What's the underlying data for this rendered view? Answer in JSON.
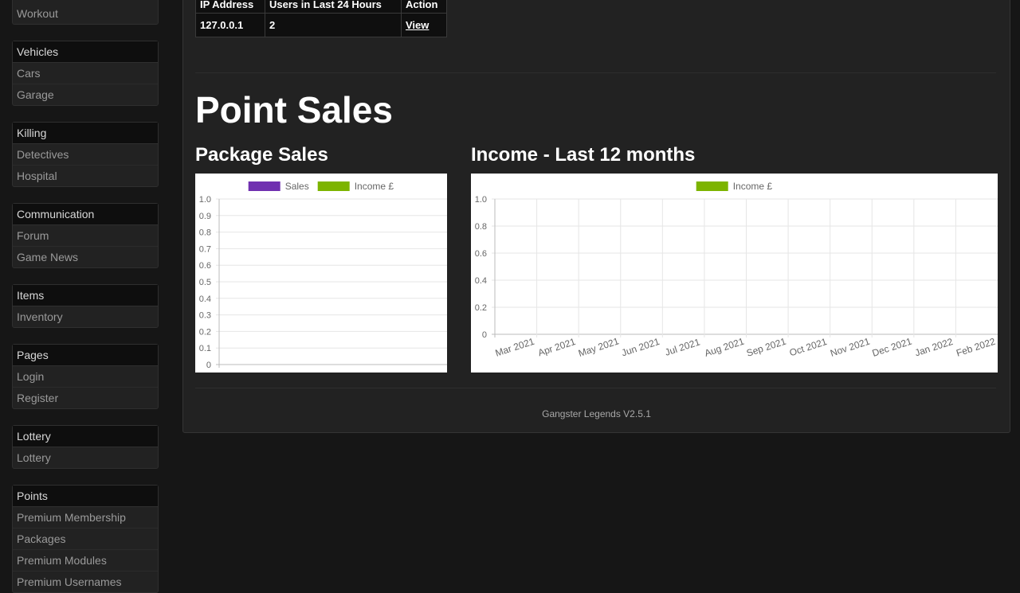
{
  "sidebar": {
    "groups": [
      {
        "head": "",
        "items": [
          "Workout"
        ]
      },
      {
        "head": "Vehicles",
        "items": [
          "Cars",
          "Garage"
        ]
      },
      {
        "head": "Killing",
        "items": [
          "Detectives",
          "Hospital"
        ]
      },
      {
        "head": "Communication",
        "items": [
          "Forum",
          "Game News"
        ]
      },
      {
        "head": "Items",
        "items": [
          "Inventory"
        ]
      },
      {
        "head": "Pages",
        "items": [
          "Login",
          "Register"
        ]
      },
      {
        "head": "Lottery",
        "items": [
          "Lottery"
        ]
      },
      {
        "head": "Points",
        "items": [
          "Premium Membership",
          "Packages",
          "Premium Modules",
          "Premium Usernames"
        ]
      }
    ]
  },
  "ip_table": {
    "headers": [
      "IP Address",
      "Users in Last 24 Hours",
      "Action"
    ],
    "rows": [
      {
        "ip": "127.0.0.1",
        "users": "2",
        "action": "View"
      }
    ]
  },
  "point_sales": {
    "title": "Point Sales",
    "package_sales_title": "Package Sales",
    "income_title": "Income - Last 12 months"
  },
  "footer": {
    "text": "Gangster Legends V2.5.1"
  },
  "chart_data": [
    {
      "type": "bar",
      "title": "",
      "series": [
        {
          "name": "Sales",
          "color": "#7030b0",
          "values": []
        },
        {
          "name": "Income £",
          "color": "#7cb400",
          "values": []
        }
      ],
      "categories": [],
      "ylim": [
        0,
        1.0
      ],
      "yticks": [
        "1.0",
        "0.9",
        "0.8",
        "0.7",
        "0.6",
        "0.5",
        "0.4",
        "0.3",
        "0.2",
        "0.1",
        "0"
      ],
      "grid": true,
      "legend": "top"
    },
    {
      "type": "bar",
      "title": "",
      "series": [
        {
          "name": "Income £",
          "color": "#7cb400",
          "values": [
            0,
            0,
            0,
            0,
            0,
            0,
            0,
            0,
            0,
            0,
            0,
            0
          ]
        }
      ],
      "categories": [
        "Mar 2021",
        "Apr 2021",
        "May 2021",
        "Jun 2021",
        "Jul 2021",
        "Aug 2021",
        "Sep 2021",
        "Oct 2021",
        "Nov 2021",
        "Dec 2021",
        "Jan 2022",
        "Feb 2022"
      ],
      "ylim": [
        0,
        1.0
      ],
      "yticks": [
        "1.0",
        "0.8",
        "0.6",
        "0.4",
        "0.2",
        "0"
      ],
      "grid": true,
      "legend": "top"
    }
  ]
}
